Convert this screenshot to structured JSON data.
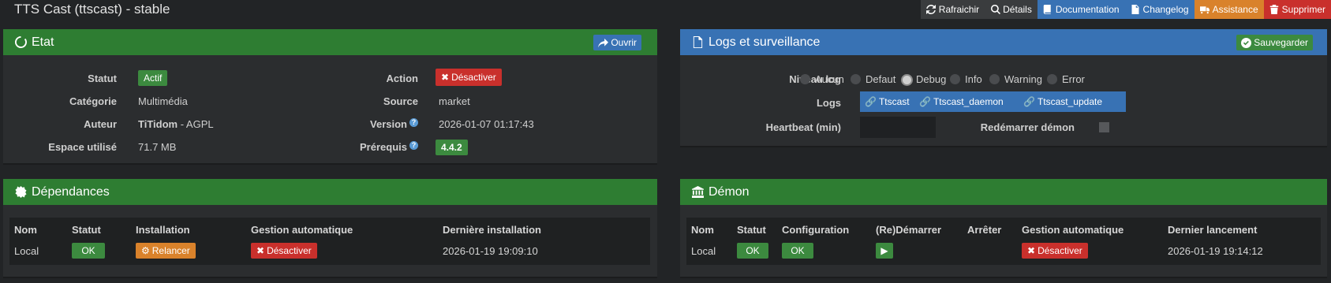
{
  "page": {
    "title": "TTS Cast (ttscast) - stable"
  },
  "topbar": {
    "refresh": "Rafraichir",
    "details": "Détails",
    "documentation": "Documentation",
    "changelog": "Changelog",
    "assistance": "Assistance",
    "delete": "Supprimer"
  },
  "colors": {
    "green": "#2e7d32",
    "blue": "#3872b4",
    "red": "#c9302c",
    "orange": "#d9822b",
    "greenBtn": "#3c8a3f",
    "darkBtn": "#3a3c3e"
  },
  "etat": {
    "title": "Etat",
    "open_label": "Ouvrir",
    "status_label": "Statut",
    "status_value": "Actif",
    "category_label": "Catégorie",
    "category_value": "Multimédia",
    "author_label": "Auteur",
    "author_name": "TiTidom",
    "author_license": " - AGPL",
    "space_label": "Espace utilisé",
    "space_value": "71.7 MB",
    "action_label": "Action",
    "action_value": "Désactiver",
    "source_label": "Source",
    "source_value": "market",
    "version_label": "Version",
    "version_value": "2026-01-07 01:17:43",
    "prereq_label": "Prérequis",
    "prereq_value": "4.4.2"
  },
  "logs": {
    "title": "Logs et surveillance",
    "save_label": "Sauvegarder",
    "level_label": "Niveau log",
    "levels": [
      "Aucun",
      "Defaut",
      "Debug",
      "Info",
      "Warning",
      "Error"
    ],
    "selected_level": "Debug",
    "logs_label": "Logs",
    "log_buttons": [
      "Ttscast",
      "Ttscast_daemon",
      "Ttscast_update"
    ],
    "heartbeat_label": "Heartbeat (min)",
    "restart_label": "Redémarrer démon"
  },
  "deps": {
    "title": "Dépendances",
    "headers": [
      "Nom",
      "Statut",
      "Installation",
      "Gestion automatique",
      "Dernière installation"
    ],
    "row": {
      "name": "Local",
      "status": "OK",
      "install": "Relancer",
      "auto": "Désactiver",
      "last": "2026-01-19 19:09:10"
    }
  },
  "daemon": {
    "title": "Démon",
    "headers": [
      "Nom",
      "Statut",
      "Configuration",
      "(Re)Démarrer",
      "Arrêter",
      "Gestion automatique",
      "Dernier lancement"
    ],
    "row": {
      "name": "Local",
      "status": "OK",
      "config": "OK",
      "auto": "Désactiver",
      "last": "2026-01-19 19:14:12"
    }
  }
}
